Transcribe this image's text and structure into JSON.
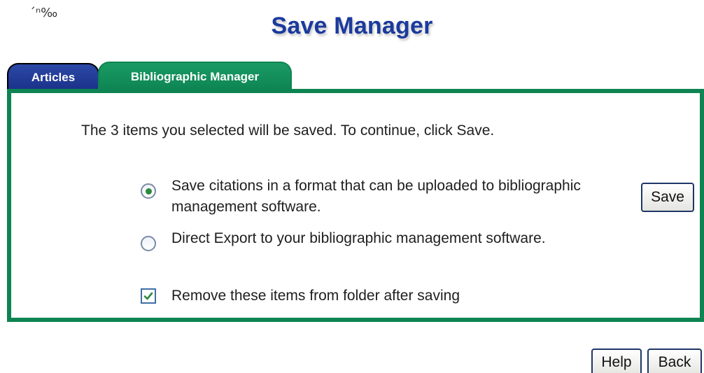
{
  "header": {
    "corner_mark": "´ⁿ‰",
    "title": "Save Manager"
  },
  "tabs": [
    {
      "label": "Articles",
      "active": false
    },
    {
      "label": "Bibliographic Manager",
      "active": true
    }
  ],
  "panel": {
    "intro": "The 3 items you selected will be saved. To continue, click Save.",
    "options": [
      {
        "label": "Save citations in a format that can be uploaded to bibliographic management software.",
        "selected": true
      },
      {
        "label": "Direct Export to your bibliographic management software.",
        "selected": false
      }
    ],
    "remove_checkbox": {
      "label": "Remove these items from folder after saving",
      "checked": true
    },
    "save_label": "Save"
  },
  "footer": {
    "help_label": "Help",
    "back_label": "Back"
  },
  "colors": {
    "title": "#1a3a9c",
    "tab_inactive": "#1a3087",
    "tab_active": "#0d8452",
    "panel_border": "#0d8452"
  }
}
